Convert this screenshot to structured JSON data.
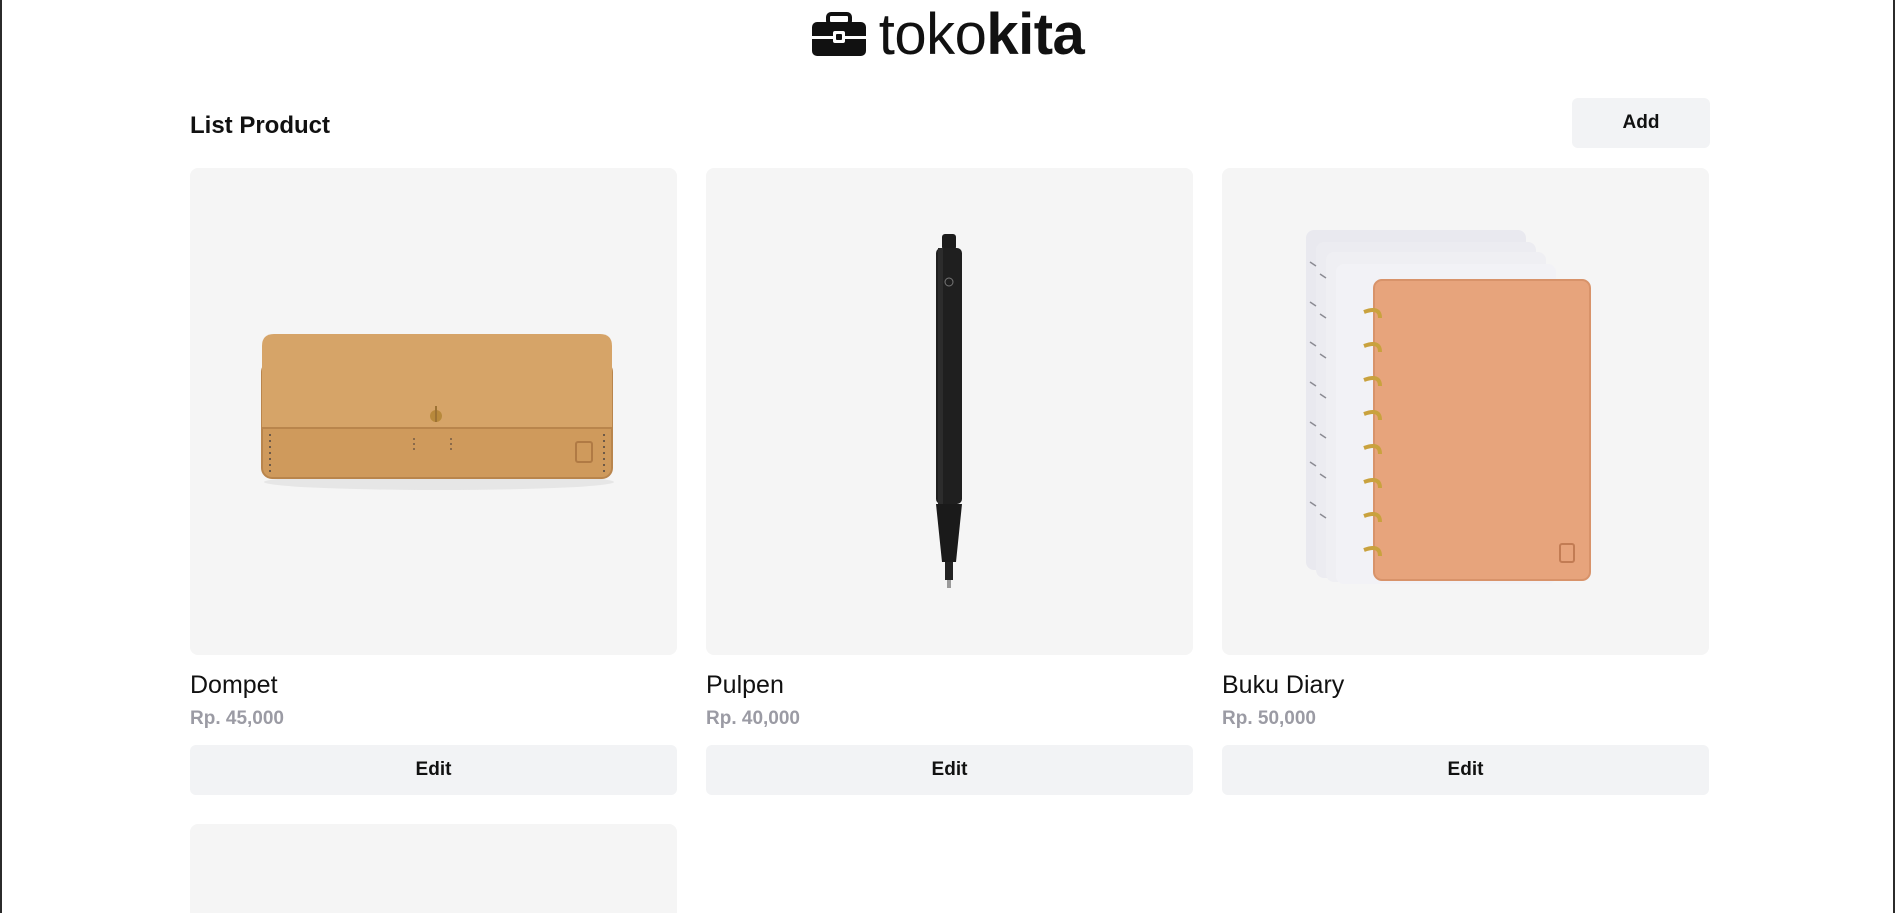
{
  "brand": {
    "name_light": "toko",
    "name_bold": "kita",
    "icon": "toolbox-icon"
  },
  "header": {
    "title": "List Product",
    "add_label": "Add"
  },
  "products": [
    {
      "name": "Dompet",
      "price": "Rp. 45,000",
      "edit_label": "Edit",
      "image": "wallet"
    },
    {
      "name": "Pulpen",
      "price": "Rp. 40,000",
      "edit_label": "Edit",
      "image": "pen"
    },
    {
      "name": "Buku Diary",
      "price": "Rp. 50,000",
      "edit_label": "Edit",
      "image": "notebook"
    }
  ],
  "colors": {
    "accent": "#111111",
    "price": "#9b9ba4",
    "button_bg": "#f2f3f5",
    "card_bg": "#f5f5f5"
  }
}
